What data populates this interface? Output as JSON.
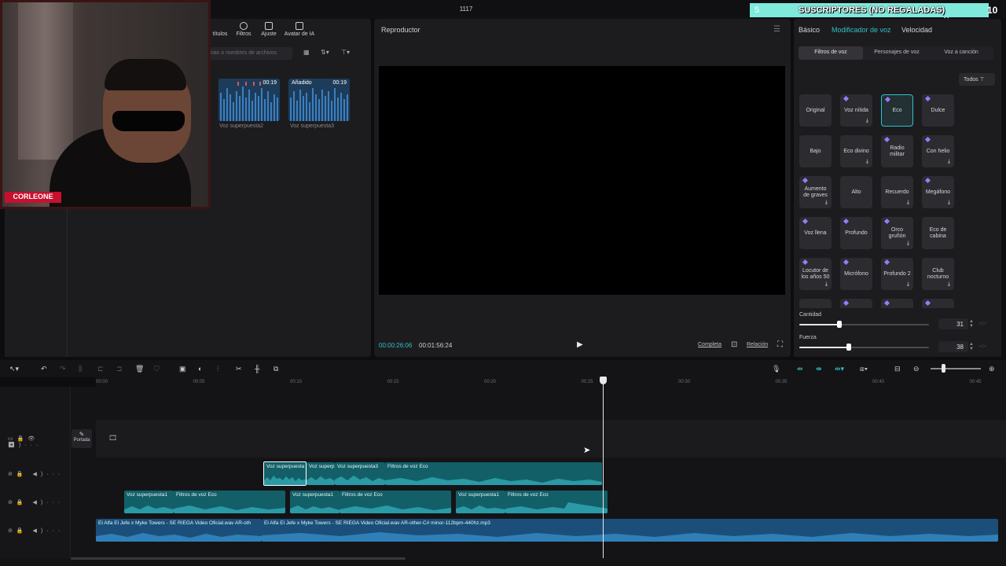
{
  "window": {
    "title": "1117",
    "controls": "– ☐ ✕"
  },
  "overlay": {
    "subscriber_goal_left": "5",
    "subscriber_text": "SUSCRIPTORES (NO REGALADAS)",
    "subscriber_goal_right": "10",
    "webcam_tag": "CORLEONE"
  },
  "media": {
    "toolbar": [
      "títulos",
      "Filtros",
      "Ajuste",
      "Avatar de IA"
    ],
    "search_placeholder": "nas o nombres de archivos",
    "thumbs": [
      {
        "name": "Voz superpuesta2",
        "duration": "00:19",
        "badge": ""
      },
      {
        "name": "Voz superpuesta3",
        "duration": "00:19",
        "badge": "Añadido"
      }
    ]
  },
  "player": {
    "title": "Reproductor",
    "menu_icon": "☰",
    "time_current": "00:00:26:06",
    "time_total": "00:01:56:24",
    "completa": "Completa",
    "relacion": "Relación"
  },
  "right": {
    "tabs": [
      "Básico",
      "Modificador de voz",
      "Velocidad"
    ],
    "subtabs": [
      "Filtros de voz",
      "Personajes de voz",
      "Voz a canción"
    ],
    "todos": "Todos",
    "filters": [
      {
        "label": "Original",
        "gem": false,
        "dl": false,
        "sel": false
      },
      {
        "label": "Voz nítida",
        "gem": true,
        "dl": true,
        "sel": false
      },
      {
        "label": "Eco",
        "gem": true,
        "dl": false,
        "sel": true
      },
      {
        "label": "Dulce",
        "gem": true,
        "dl": false,
        "sel": false
      },
      {
        "label": "Bajo",
        "gem": false,
        "dl": false,
        "sel": false
      },
      {
        "label": "Eco divino",
        "gem": false,
        "dl": true,
        "sel": false
      },
      {
        "label": "Radio militar",
        "gem": true,
        "dl": false,
        "sel": false
      },
      {
        "label": "Con helio",
        "gem": true,
        "dl": true,
        "sel": false
      },
      {
        "label": "Aumento de graves",
        "gem": true,
        "dl": true,
        "sel": false
      },
      {
        "label": "Alto",
        "gem": false,
        "dl": false,
        "sel": false
      },
      {
        "label": "Recuerdo",
        "gem": false,
        "dl": true,
        "sel": false
      },
      {
        "label": "Megáfono",
        "gem": true,
        "dl": true,
        "sel": false
      },
      {
        "label": "Voz llena",
        "gem": true,
        "dl": false,
        "sel": false
      },
      {
        "label": "Profundo",
        "gem": true,
        "dl": false,
        "sel": false
      },
      {
        "label": "Orco gruñón",
        "gem": true,
        "dl": true,
        "sel": false
      },
      {
        "label": "Eco de cabina",
        "gem": false,
        "dl": false,
        "sel": false
      },
      {
        "label": "Locutor de los años 50",
        "gem": true,
        "dl": true,
        "sel": false
      },
      {
        "label": "Micrófono",
        "gem": true,
        "dl": false,
        "sel": false
      },
      {
        "label": "Profundo 2",
        "gem": true,
        "dl": true,
        "sel": false
      },
      {
        "label": "Club nocturno",
        "gem": false,
        "dl": true,
        "sel": false
      }
    ],
    "sliders": [
      {
        "label": "Cantidad",
        "value": "31",
        "fraction": 0.31
      },
      {
        "label": "Fuerza",
        "value": "38",
        "fraction": 0.38
      }
    ]
  },
  "timeline": {
    "ticks": [
      "00:00",
      "00:05",
      "00:10",
      "00:15",
      "00:20",
      "00:25",
      "00:30",
      "00:35",
      "00:40",
      "00:45"
    ],
    "portada": "Portada",
    "clips_row1": [
      {
        "label": "Voz superpuesta"
      },
      {
        "label": "Voz superp"
      },
      {
        "label": "Voz superpuesta3"
      },
      {
        "label": "Filtros de voz Eco"
      }
    ],
    "clips_row2": [
      {
        "label": "Voz superpuesta1"
      },
      {
        "label": "Filtros de voz Eco"
      },
      {
        "label": "Voz superpuesta1"
      },
      {
        "label": "Filtros de voz Eco"
      },
      {
        "label": "Voz superpuesta1"
      },
      {
        "label": "Filtros de voz Eco"
      }
    ],
    "clips_row3": [
      {
        "label": "El Alfa El Jefe x Myke Towers - SE RIEGA   Video Oficial.wav AR-oth"
      },
      {
        "label": "El Alfa El Jefe x Myke Towers - SE RIEGA   Video Oficial.wav AR-other-C# minor-112bpm-440hz.mp3"
      }
    ]
  }
}
